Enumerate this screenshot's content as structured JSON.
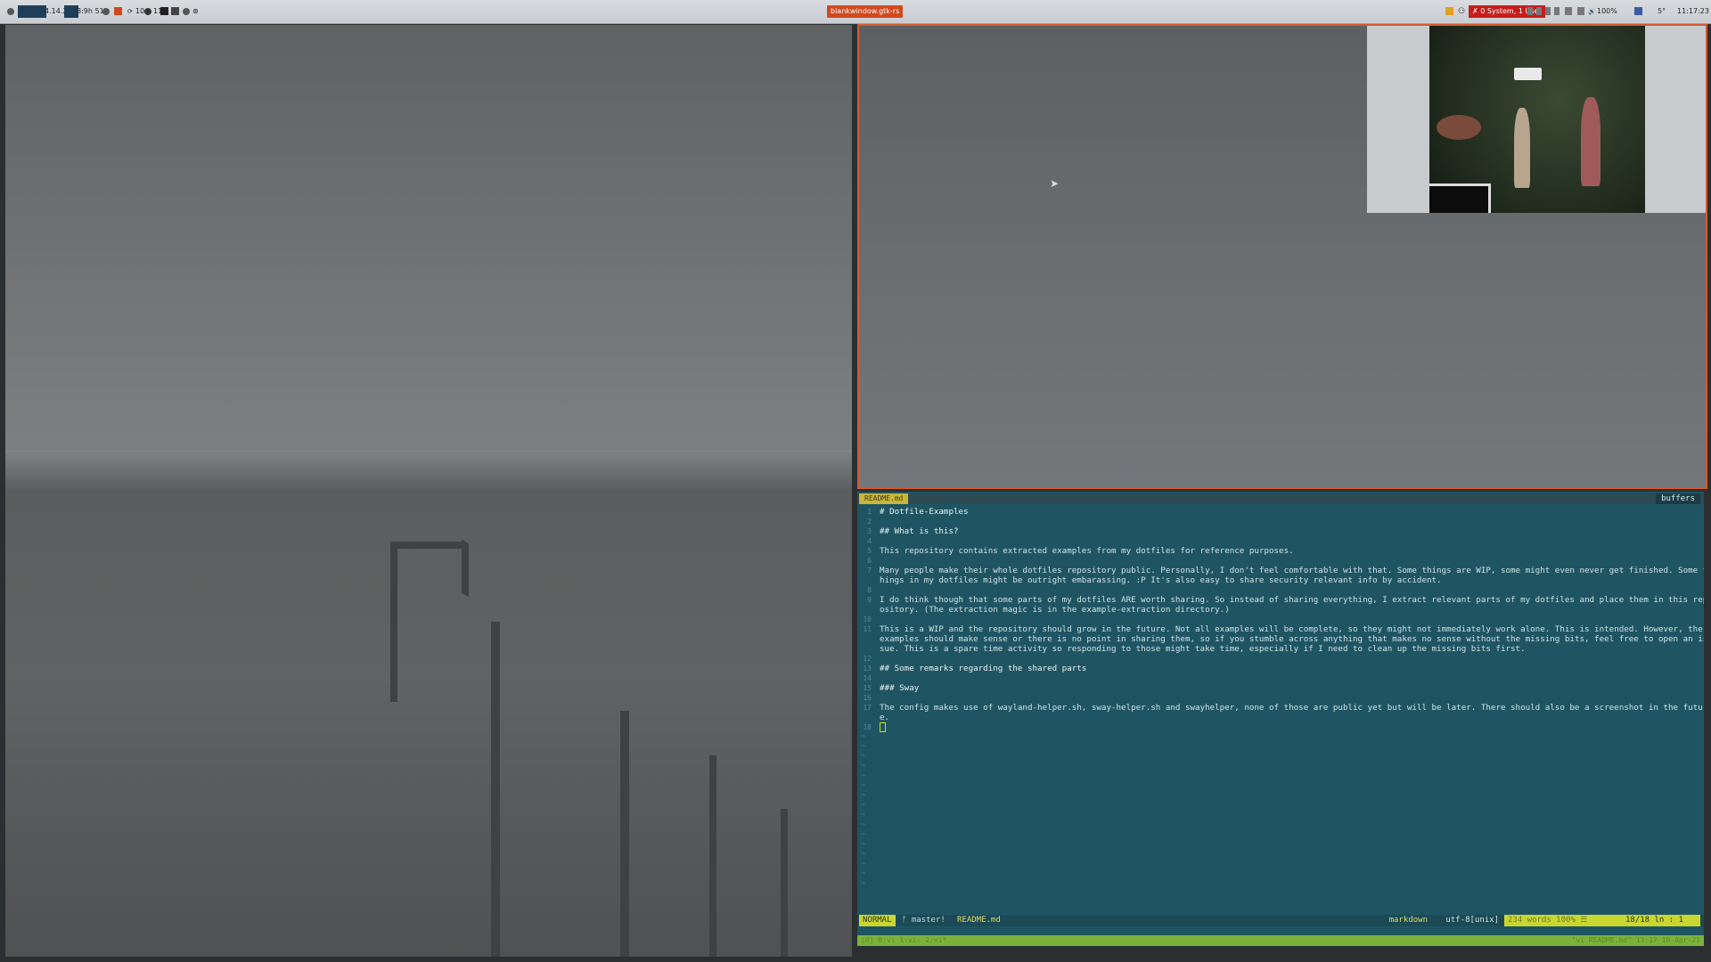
{
  "topbar": {
    "left_item_1": "4.14.2",
    "left_item_2": "8:9h 51'",
    "left_item_3": "10",
    "left_item_4": "11",
    "window_title": "blankwindow.gtk-rs",
    "status_alert": "✗ 0 System, 1 User",
    "volume": "100%",
    "weather": "5°",
    "clock": "11:17:23"
  },
  "editor": {
    "tab_label": "README.md",
    "buffers_label": "buffers",
    "lines": [
      {
        "num": "1",
        "text": "# Dotfile-Examples",
        "heading": true
      },
      {
        "num": "2",
        "text": ""
      },
      {
        "num": "3",
        "text": "## What is this?",
        "heading": true
      },
      {
        "num": "4",
        "text": ""
      },
      {
        "num": "5",
        "text": "This repository contains extracted examples from my dotfiles for reference purposes."
      },
      {
        "num": "6",
        "text": ""
      },
      {
        "num": "7",
        "text": "Many people make their whole dotfiles repository public. Personally, I don't feel comfortable with that. Some things are WIP, some might even never get finished. Some t"
      },
      {
        "num": "",
        "text": "hings in my dotfiles might be outright embarassing. :P It's also easy to share security relevant info by accident."
      },
      {
        "num": "8",
        "text": ""
      },
      {
        "num": "9",
        "text": "I do think though that some parts of my dotfiles ARE worth sharing. So instead of sharing everything, I extract relevant parts of my dotfiles and place them in this rep"
      },
      {
        "num": "",
        "text": "ository. (The extraction magic is in the example-extraction directory.)"
      },
      {
        "num": "10",
        "text": ""
      },
      {
        "num": "11",
        "text": "This is a WIP and the repository should grow in the future. Not all examples will be complete, so they might not immediately work alone. This is intended. However, the"
      },
      {
        "num": "",
        "text": "examples should make sense or there is no point in sharing them, so if you stumble across anything that makes no sense without the missing bits, feel free to open an is"
      },
      {
        "num": "",
        "text": "sue. This is a spare time activity so responding to those might take time, especially if I need to clean up the missing bits first."
      },
      {
        "num": "12",
        "text": ""
      },
      {
        "num": "13",
        "text": "## Some remarks regarding the shared parts",
        "heading": true
      },
      {
        "num": "14",
        "text": ""
      },
      {
        "num": "15",
        "text": "### Sway",
        "heading": true
      },
      {
        "num": "16",
        "text": ""
      },
      {
        "num": "17",
        "text": "The config makes use of wayland-helper.sh, sway-helper.sh and swayhelper, none of those are public yet but will be later. There should also be a screenshot in the futur"
      },
      {
        "num": "",
        "text": "e."
      },
      {
        "num": "18",
        "text": ""
      }
    ],
    "status": {
      "mode": "NORMAL",
      "branch": "ᚠ master!",
      "file": "README.md",
      "filetype": "markdown",
      "encoding": "utf-8[unix]",
      "words": "234 words  100%  ☰",
      "position": "18/18  ln :  1"
    },
    "tmux": {
      "left": "[0] 0:vi  1:vi- 2:vi*",
      "right": "\"vi README.md\" 11:17 18-Apr-21"
    }
  }
}
